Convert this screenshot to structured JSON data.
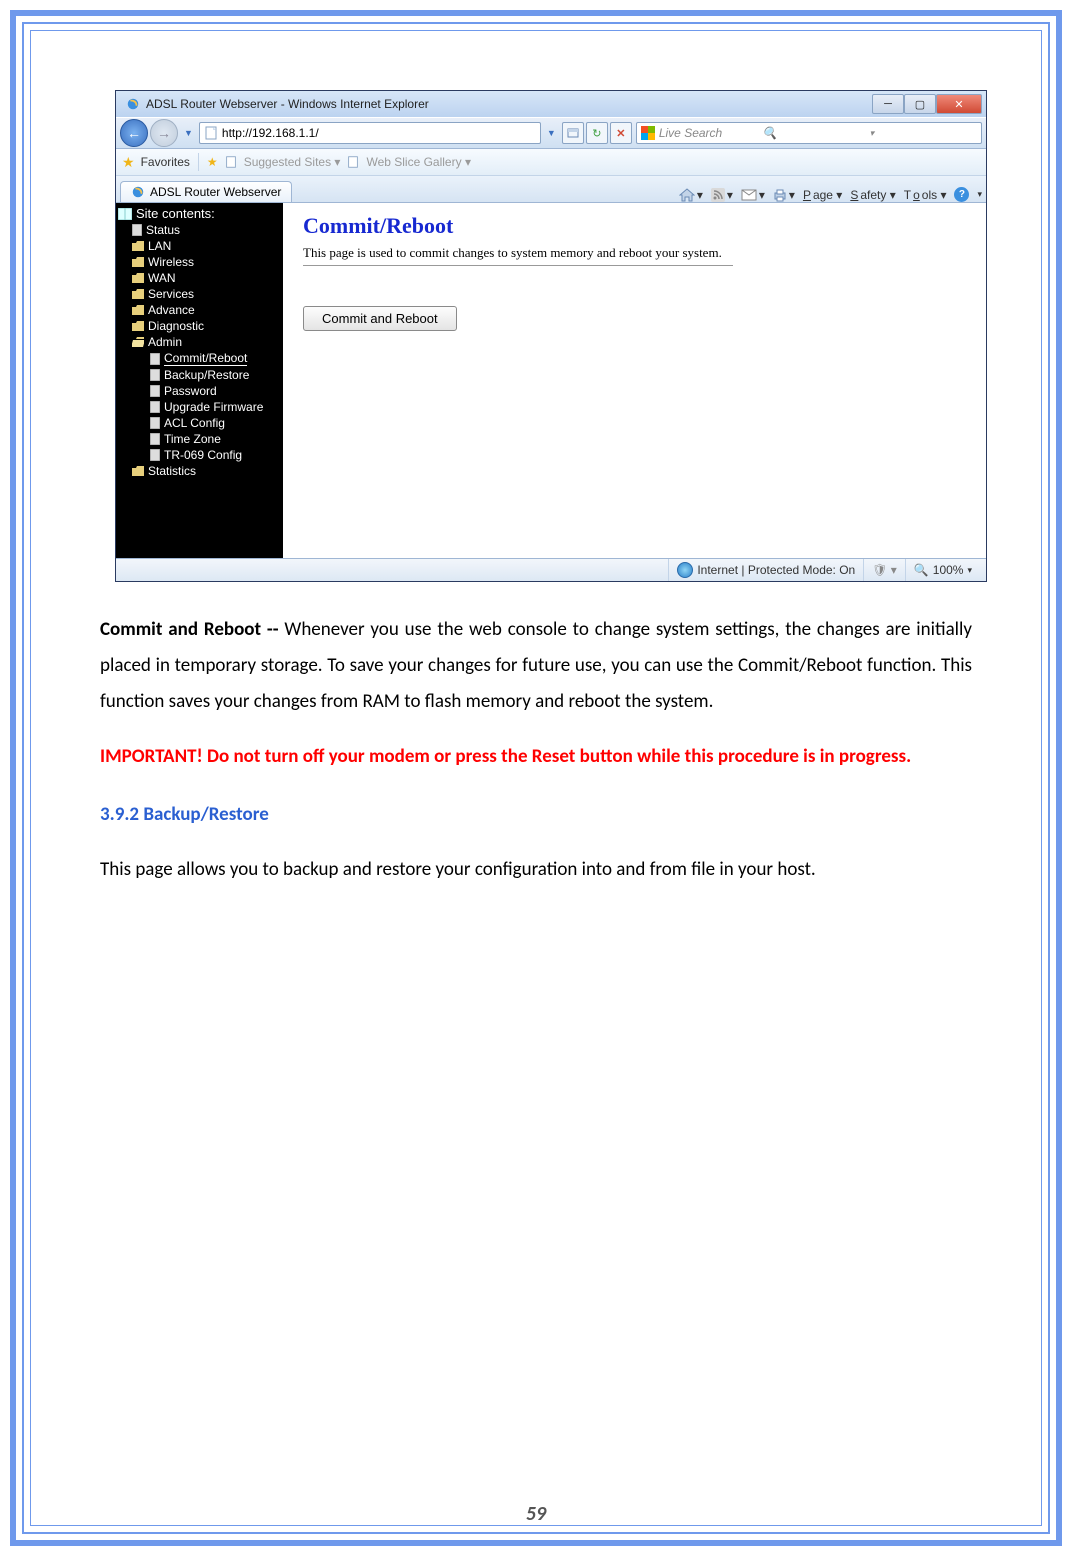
{
  "browser": {
    "title": "ADSL Router Webserver - Windows Internet Explorer",
    "url": "http://192.168.1.1/",
    "search_placeholder": "Live Search",
    "favorites_label": "Favorites",
    "suggested": "Suggested Sites",
    "webslice": "Web Slice Gallery",
    "tab_title": "ADSL Router Webserver",
    "menu": {
      "page": "Page",
      "safety": "Safety",
      "tools": "Tools"
    },
    "status": {
      "mode": "Internet | Protected Mode: On",
      "zoom": "100%"
    }
  },
  "sidebar": {
    "header": "Site contents:",
    "items": [
      "Status",
      "LAN",
      "Wireless",
      "WAN",
      "Services",
      "Advance",
      "Diagnostic"
    ],
    "admin": {
      "label": "Admin",
      "children": [
        "Commit/Reboot",
        "Backup/Restore",
        "Password",
        "Upgrade Firmware",
        "ACL Config",
        "Time Zone",
        "TR-069 Config"
      ]
    },
    "stats": "Statistics"
  },
  "main": {
    "heading": "Commit/Reboot",
    "desc": "This page is used to commit changes to system memory and reboot your system.",
    "button": "Commit and Reboot"
  },
  "doc": {
    "para1_lead": "Commit and Reboot -- ",
    "para1": "Whenever you use the web console to change system settings, the changes are initially placed in temporary storage. To save your changes for future use, you can use the Commit/Reboot function. This function saves your changes from RAM to flash memory and reboot the system.",
    "warning": "IMPORTANT! Do not turn off your modem or press the Reset button while this procedure is in progress.",
    "section": "3.9.2 Backup/Restore",
    "para2": "This page allows you to backup and restore your configuration into and from file in your host."
  },
  "page_number": "59"
}
